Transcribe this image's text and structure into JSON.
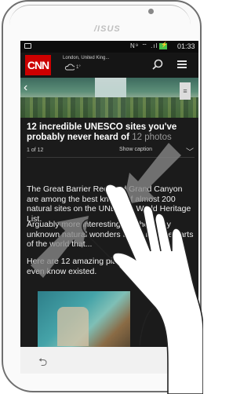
{
  "device": {
    "brand": "/ISUS"
  },
  "status_bar": {
    "time": "01:33",
    "icons": "N⁹ ⌔ .ıl"
  },
  "header": {
    "logo": "CNN",
    "location": "London, United King...",
    "temperature": "1°"
  },
  "article": {
    "title": "12 incredible UNESCO sites you've probably never heard of",
    "photo_count": "12 photos",
    "counter": "1 of 12",
    "caption_toggle": "Show caption",
    "paragraphs": [
      "The Great Barrier Reef and Grand Canyon are among the best known of almost 200 natural sites on the UNESCO World Heritage List.",
      "Arguably more interesting are the many unknown natural wonders found in large parts of the world that...",
      "Here are 12 amazing places you may not even know existed."
    ]
  },
  "icons": {
    "search": "search-icon",
    "menu": "menu-icon",
    "weather": "cloud-icon",
    "back": "back-icon"
  },
  "colors": {
    "cnn_red": "#cc0000",
    "battery_green": "#47c04a"
  }
}
